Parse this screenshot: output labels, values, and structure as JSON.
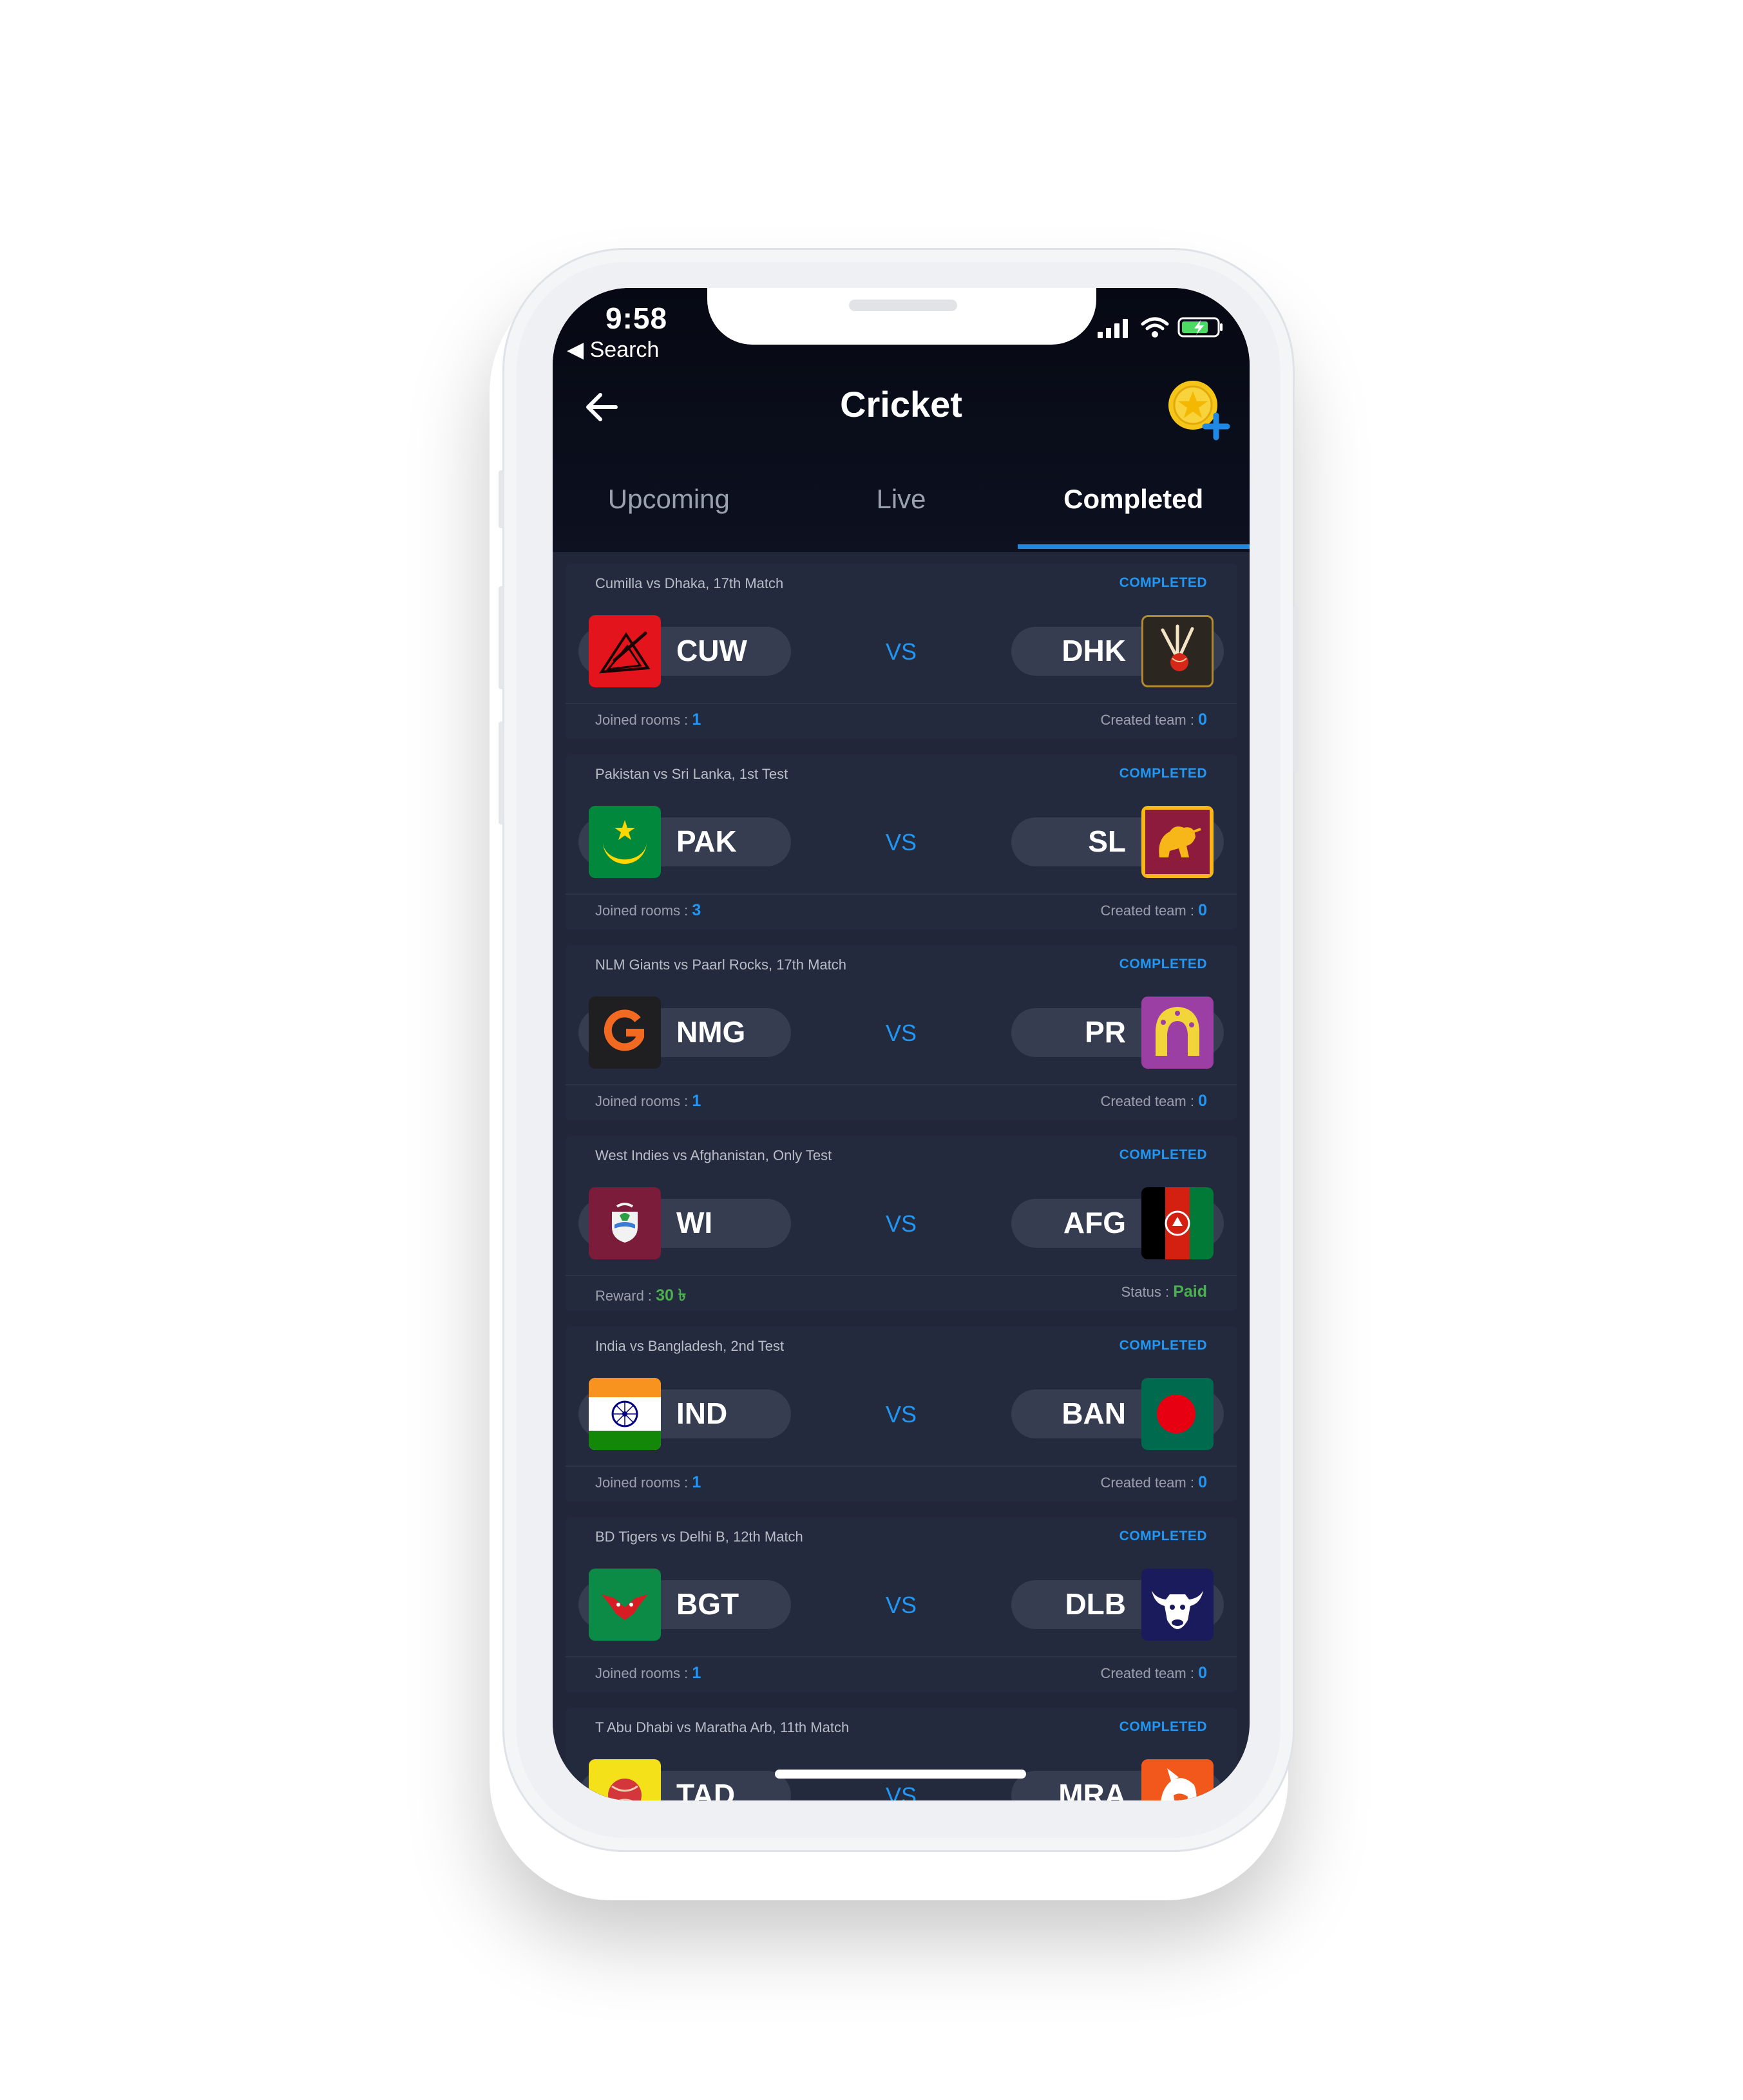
{
  "status_bar": {
    "time": "9:58",
    "back_label": "◀ Search"
  },
  "header": {
    "title": "Cricket"
  },
  "tabs": [
    {
      "label": "Upcoming"
    },
    {
      "label": "Live"
    },
    {
      "label": "Completed"
    }
  ],
  "active_tab": "Completed",
  "colors": {
    "accent": "#1e88e5",
    "background": "#212638",
    "card": "#232a3d",
    "green": "#4caf50"
  },
  "vs_label": "VS",
  "matches": [
    {
      "name": "Cumilla vs Dhaka, 17th Match",
      "status": "COMPLETED",
      "team1": {
        "code": "CUW",
        "icon": "cumilla-warriors-logo"
      },
      "team2": {
        "code": "DHK",
        "icon": "dhaka-logo"
      },
      "foot_left_label": "Joined rooms : ",
      "foot_left_value": "1",
      "foot_right_label": "Created team : ",
      "foot_right_value": "0"
    },
    {
      "name": "Pakistan vs Sri Lanka, 1st Test",
      "status": "COMPLETED",
      "team1": {
        "code": "PAK",
        "icon": "pakistan-flag"
      },
      "team2": {
        "code": "SL",
        "icon": "sri-lanka-flag"
      },
      "foot_left_label": "Joined rooms : ",
      "foot_left_value": "3",
      "foot_right_label": "Created team : ",
      "foot_right_value": "0"
    },
    {
      "name": "NLM Giants vs Paarl Rocks, 17th Match",
      "status": "COMPLETED",
      "team1": {
        "code": "NMG",
        "icon": "nmg-logo"
      },
      "team2": {
        "code": "PR",
        "icon": "paarl-rocks-logo"
      },
      "foot_left_label": "Joined rooms : ",
      "foot_left_value": "1",
      "foot_right_label": "Created team : ",
      "foot_right_value": "0"
    },
    {
      "name": "West Indies vs Afghanistan, Only Test",
      "status": "COMPLETED",
      "team1": {
        "code": "WI",
        "icon": "west-indies-logo"
      },
      "team2": {
        "code": "AFG",
        "icon": "afghanistan-flag"
      },
      "foot_left_label": "Reward : ",
      "foot_left_value": "30 ৳",
      "foot_right_label": "Status : ",
      "foot_right_value": "Paid"
    },
    {
      "name": "India vs Bangladesh, 2nd Test",
      "status": "COMPLETED",
      "team1": {
        "code": "IND",
        "icon": "india-flag"
      },
      "team2": {
        "code": "BAN",
        "icon": "bangladesh-flag"
      },
      "foot_left_label": "Joined rooms : ",
      "foot_left_value": "1",
      "foot_right_label": "Created team : ",
      "foot_right_value": "0"
    },
    {
      "name": "BD Tigers vs Delhi B, 12th Match",
      "status": "COMPLETED",
      "team1": {
        "code": "BGT",
        "icon": "bd-tigers-logo"
      },
      "team2": {
        "code": "DLB",
        "icon": "delhi-bulls-logo"
      },
      "foot_left_label": "Joined rooms : ",
      "foot_left_value": "1",
      "foot_right_label": "Created team : ",
      "foot_right_value": "0"
    },
    {
      "name": "T Abu Dhabi vs Maratha Arb, 11th Match",
      "status": "COMPLETED",
      "team1": {
        "code": "TAD",
        "icon": "abu-dhabi-logo"
      },
      "team2": {
        "code": "MRA",
        "icon": "maratha-arabians-logo"
      }
    }
  ]
}
